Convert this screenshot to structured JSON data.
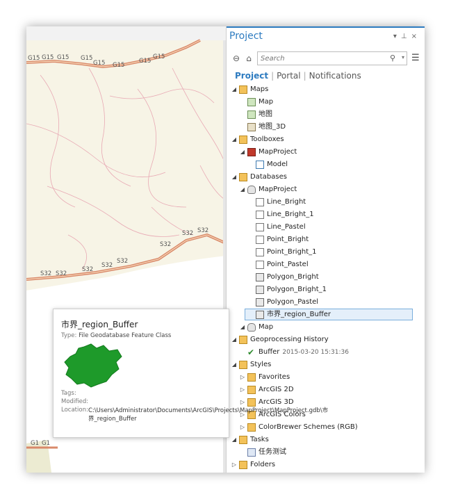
{
  "map": {
    "road_g15_label": "G15",
    "road_s32_label": "S32",
    "road_g1_label": "G1"
  },
  "pane": {
    "title": "Project",
    "search_placeholder": "Search",
    "tabs": [
      "Project",
      "Portal",
      "Notifications"
    ]
  },
  "tree": {
    "maps": "Maps",
    "map": "Map",
    "map_cn": "地图",
    "map_3d": "地图_3D",
    "toolboxes": "Toolboxes",
    "map_project_tbx": "MapProject",
    "model": "Model",
    "databases": "Databases",
    "map_project_gdb": "MapProject",
    "line_bright": "Line_Bright",
    "line_bright_1": "Line_Bright_1",
    "line_pastel": "Line_Pastel",
    "point_bright": "Point_Bright",
    "point_bright_1": "Point_Bright_1",
    "point_pastel": "Point_Pastel",
    "polygon_bright": "Polygon_Bright",
    "polygon_bright_1": "Polygon_Bright_1",
    "polygon_pastel": "Polygon_Pastel",
    "region_buffer": "市界_region_Buffer",
    "map_db": "Map",
    "geoprocessing_history": "Geoprocessing History",
    "buffer": "Buffer",
    "buffer_time": "2015-03-20 15:31:36",
    "styles": "Styles",
    "favorites": "Favorites",
    "arcgis_2d": "ArcGIS 2D",
    "arcgis_3d": "ArcGIS 3D",
    "arcgis_colors": "ArcGIS Colors",
    "colorbrewer": "ColorBrewer Schemes (RGB)",
    "tasks": "Tasks",
    "task_test": "任务测试",
    "folders": "Folders"
  },
  "popup": {
    "title": "市界_region_Buffer",
    "type_label": "Type:",
    "type_value": "File Geodatabase Feature Class",
    "tags_label": "Tags:",
    "modified_label": "Modified:",
    "location_label": "Location:",
    "location_value": "C:\\Users\\Administrator\\Documents\\ArcGIS\\Projects\\MapProject\\MapProject.gdb\\市界_region_Buffer"
  },
  "colors": {
    "accent": "#2d7bc0",
    "polygon_fill": "#1e9a2a",
    "road": "#d9896a"
  }
}
